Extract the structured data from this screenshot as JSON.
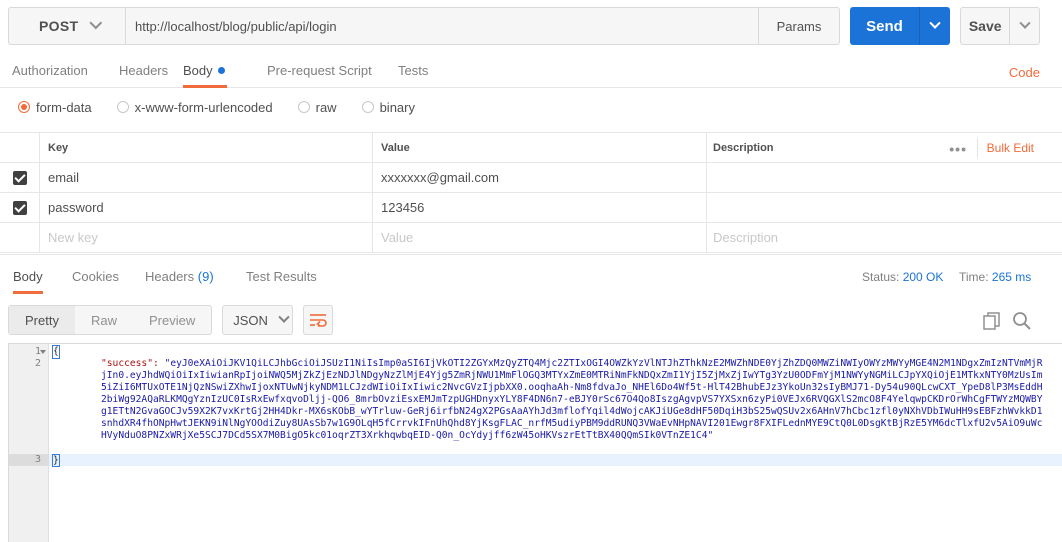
{
  "request": {
    "method": "POST",
    "url": "http://localhost/blog/public/api/login",
    "params_label": "Params",
    "send_label": "Send",
    "save_label": "Save"
  },
  "request_tabs": {
    "authorization": "Authorization",
    "headers": "Headers",
    "body": "Body",
    "prescript": "Pre-request Script",
    "tests": "Tests",
    "code": "Code"
  },
  "body_types": {
    "form_data": "form-data",
    "urlencoded": "x-www-form-urlencoded",
    "raw": "raw",
    "binary": "binary",
    "selected": "form-data"
  },
  "kv_table": {
    "headers": {
      "key": "Key",
      "value": "Value",
      "description": "Description"
    },
    "more": "•••",
    "bulk_edit": "Bulk Edit",
    "rows": [
      {
        "checked": true,
        "key": "email",
        "value": "xxxxxxx@gmail.com"
      },
      {
        "checked": true,
        "key": "password",
        "value": "123456"
      }
    ],
    "new_row": {
      "key": "New key",
      "value": "Value",
      "description": "Description"
    }
  },
  "response_tabs": {
    "body": "Body",
    "cookies": "Cookies",
    "headers": "Headers",
    "headers_count": "(9)",
    "test_results": "Test Results",
    "status_label": "Status:",
    "status_value": "200 OK",
    "time_label": "Time:",
    "time_value": "265 ms"
  },
  "response_toolbar": {
    "pretty": "Pretty",
    "raw": "Raw",
    "preview": "Preview",
    "format": "JSON"
  },
  "editor": {
    "line_numbers": [
      "1",
      "2",
      "3"
    ],
    "open_brace": "{",
    "close_brace": "}",
    "key": "\"success\":",
    "token": "\"eyJ0eXAiOiJKV1QiLCJhbGciOiJSUzI1NiIsImp0aSI6IjVkOTI2ZGYxMzQyZTQ4Mjc2ZTIxOGI4OWZkYzVlNTJhZThkNzE2MWZhNDE0YjZhZDQ0MWZiNWIyOWYzMWYyMGE4N2M1NDgxZmIzNTVmMjRjIn0.eyJhdWQiOiIxIiwianRpIjoiNWQ5MjZkZjEzNDJlNDgyNzZlMjE4Yjg5ZmRjNWU1MmFlOGQ3MTYxZmE0MTRiNmFkNDQxZmI1YjI5ZjMxZjIwYTg3YzU0ODFmYjM1NWYyNGMiLCJpYXQiOjE1MTkxNTY0MzUsIm5iZiI6MTUxOTE1NjQzNSwiZXhwIjoxNTUwNjkyNDM1LCJzdWIiOiIxIiwic2NvcGVzIjpbXX0.ooqhaAh-Nm8fdvaJo_NHEl6Do4Wf5t-HlT42BhubEJz3YkoUn32sIyBMJ71-Dy54u90QLcwCXT_YpeD8lP3MsEddH2biWg92AQaRLKMQgYznIzUC0IsRxEwfxqvoDljj-QO6_8mrbOvziEsxEMJmTzpUGHDnyxYLY8F4DN6n7-eBJY0rSc67O4Qo8IszgAgvpVS7YXSxn6zyPi0VEJx6RVQGXlS2mcO8F4YelqwpCKDrOrWhCgFTWYzMQWBYg1ETtN2GvaGOCJv59X2K7vxKrtGj2HH4Dkr-MX6sKObB_wYTrluw-GeRj6irfbN24gX2PGsAaAYhJd3mflofYqil4dWojcAKJiUGe8dHF50DqiH3bS25wQSUv2x6AHnV7hCbc1zfl0yNXhVDbIWuHH9sEBFzhWvkkD1snhdXR4fhONpHwtJEKN9iNlNgYOOdiZuy8UAsSb7w1G9OLqH5fCrrvkIFnUhQhd8YjKsgFLAC_nrfM5udiyPBM9ddRUNQ3VWaEvNHpNAVI201Ewgr8FXIFLednMYE9CtQ0L0DsgKtBjRzE5YM6dcTlxfU2v5AiO9uWcHVyNduO8PNZxWRjXe5SCJ7DCd5SX7M0BigO5kc01oqrZT3XrkhqwbqEID-Q0n_OcYdyjff6zW45oHKVszrEtTtBX40QQmSIk0VTnZE1C4\""
  }
}
